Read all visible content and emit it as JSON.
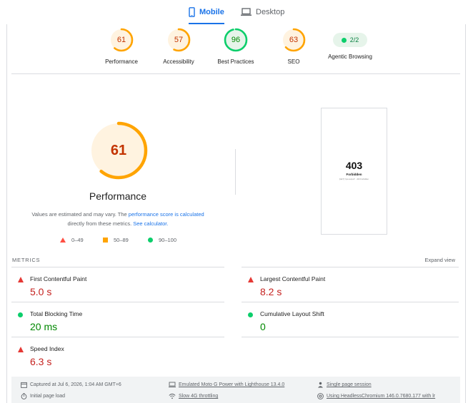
{
  "tabs": [
    {
      "label": "Mobile",
      "active": true
    },
    {
      "label": "Desktop",
      "active": false
    }
  ],
  "gauges": [
    {
      "score": "61",
      "label": "Performance",
      "status": "average",
      "fraction": 0.61
    },
    {
      "score": "57",
      "label": "Accessibility",
      "status": "average",
      "fraction": 0.57
    },
    {
      "score": "96",
      "label": "Best Practices",
      "status": "pass",
      "fraction": 0.96
    },
    {
      "score": "63",
      "label": "SEO",
      "status": "average",
      "fraction": 0.63
    }
  ],
  "agentic": {
    "value": "2/2",
    "label": "Agentic Browsing"
  },
  "performance": {
    "score": "61",
    "fraction": 0.61,
    "title": "Performance",
    "note_prefix": "Values are estimated and may vary. The ",
    "note_link1": "performance score is calculated",
    "note_middle": " directly from these metrics. ",
    "note_link2": "See calculator."
  },
  "legend": {
    "fail": "0–49",
    "average": "50–89",
    "pass": "90–100"
  },
  "screenshot": {
    "code": "403",
    "text": "Forbidden",
    "small": "[GET] \"/psi-output/\" - 403 Forbidden"
  },
  "metrics": {
    "heading": "METRICS",
    "expand_label": "Expand view",
    "items": [
      {
        "name": "First Contentful Paint",
        "value": "5.0 s",
        "status": "fail"
      },
      {
        "name": "Largest Contentful Paint",
        "value": "8.2 s",
        "status": "fail"
      },
      {
        "name": "Total Blocking Time",
        "value": "20 ms",
        "status": "pass"
      },
      {
        "name": "Cumulative Layout Shift",
        "value": "0",
        "status": "pass"
      },
      {
        "name": "Speed Index",
        "value": "6.3 s",
        "status": "fail"
      }
    ]
  },
  "footer": {
    "captured": "Captured at Jul 6, 2026, 1:04 AM GMT+6",
    "device": "Emulated Moto G Power with Lighthouse 13.4.0",
    "session": "Single page session",
    "load": "Initial page load",
    "throttling": "Slow 4G throttling",
    "browser": "Using HeadlessChromium 146.0.7680.177 with lr"
  },
  "colors": {
    "average": "#ffa400",
    "pass": "#0cce6b",
    "fail": "#ff4e42",
    "accent": "#1a73e8"
  }
}
